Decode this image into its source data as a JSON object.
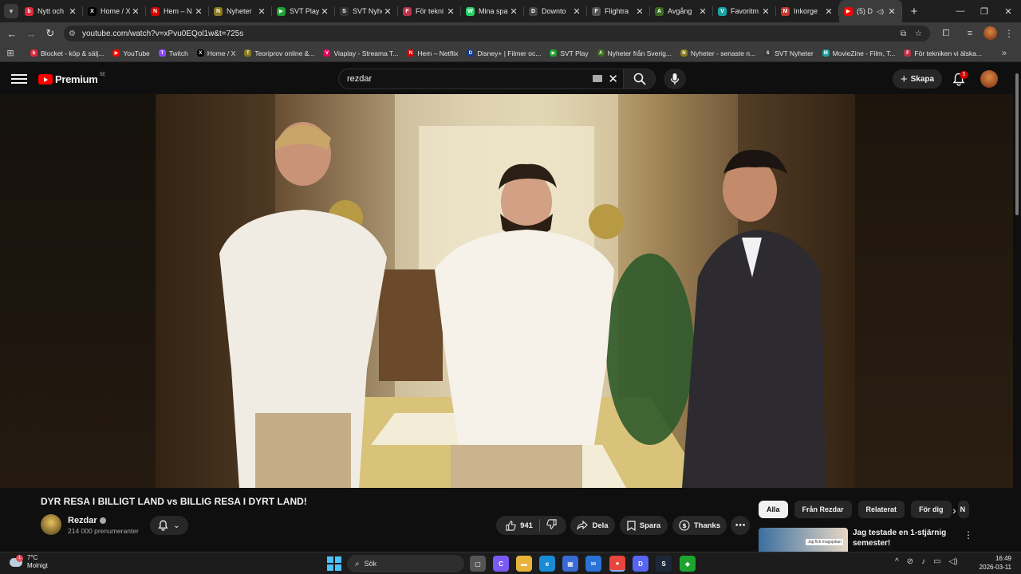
{
  "browser": {
    "tabs": [
      {
        "title": "Nytt och",
        "favicon": "red-circle-icon",
        "color": "#e0283a",
        "glyph": "b"
      },
      {
        "title": "Home / X",
        "favicon": "x-logo-icon",
        "color": "#000000",
        "glyph": "X"
      },
      {
        "title": "Hem – N",
        "favicon": "netflix-icon",
        "color": "#d80000",
        "glyph": "N"
      },
      {
        "title": "Nyheter",
        "favicon": "nyheter-icon",
        "color": "#8a7a20",
        "glyph": "N"
      },
      {
        "title": "SVT Play",
        "favicon": "play-green-icon",
        "color": "#1fa330",
        "glyph": "▶"
      },
      {
        "title": "SVT Nyhe",
        "favicon": "svt-icon",
        "color": "#333333",
        "glyph": "S"
      },
      {
        "title": "För tekni",
        "favicon": "tech-icon",
        "color": "#c03048",
        "glyph": "F"
      },
      {
        "title": "Mina spa",
        "favicon": "whatsapp-icon",
        "color": "#25d366",
        "glyph": "W"
      },
      {
        "title": "Downto",
        "favicon": "download-icon",
        "color": "#444444",
        "glyph": "D"
      },
      {
        "title": "Flightra",
        "favicon": "flight-icon",
        "color": "#555555",
        "glyph": "F"
      },
      {
        "title": "Avgång",
        "favicon": "departure-icon",
        "color": "#3a6a20",
        "glyph": "A"
      },
      {
        "title": "Favoritm",
        "favicon": "v-icon",
        "color": "#1aa3a3",
        "glyph": "V"
      },
      {
        "title": "Inkorge",
        "favicon": "gmail-icon",
        "color": "#c33a2e",
        "glyph": "M"
      },
      {
        "title": "(5) D",
        "favicon": "youtube-icon",
        "color": "#ff0000",
        "glyph": "▶"
      }
    ],
    "new_tab": "+",
    "url": "youtube.com/watch?v=xPvu0EQol1w&t=725s",
    "bookmarks": [
      {
        "label": "Blocket - köp & sälj...",
        "favicon": "blocket-icon",
        "color": "#e0283a",
        "glyph": "b"
      },
      {
        "label": "YouTube",
        "favicon": "youtube-icon",
        "color": "#ff0000",
        "glyph": "▶"
      },
      {
        "label": "Twitch",
        "favicon": "twitch-icon",
        "color": "#9146ff",
        "glyph": "T"
      },
      {
        "label": "Home / X",
        "favicon": "x-logo-icon",
        "color": "#000000",
        "glyph": "X"
      },
      {
        "label": "Teoriprov online &...",
        "favicon": "teoriprov-icon",
        "color": "#8a7a20",
        "glyph": "T"
      },
      {
        "label": "Viaplay - Streama T...",
        "favicon": "viaplay-icon",
        "color": "#e5005b",
        "glyph": "V"
      },
      {
        "label": "Hem – Netflix",
        "favicon": "netflix-icon",
        "color": "#d80000",
        "glyph": "N"
      },
      {
        "label": "Disney+ | Filmer oc...",
        "favicon": "disney-icon",
        "color": "#123a8a",
        "glyph": "D"
      },
      {
        "label": "SVT Play",
        "favicon": "play-green-icon",
        "color": "#1fa330",
        "glyph": "▶"
      },
      {
        "label": "Nyheter från Sverig...",
        "favicon": "news-icon",
        "color": "#3a6a20",
        "glyph": "A"
      },
      {
        "label": "Nyheter - senaste n...",
        "favicon": "nyheter-icon",
        "color": "#8a7a20",
        "glyph": "N"
      },
      {
        "label": "SVT Nyheter",
        "favicon": "svt-icon",
        "color": "#333333",
        "glyph": "S"
      },
      {
        "label": "MovieZine - Film, T...",
        "favicon": "moviezine-icon",
        "color": "#1aa3a3",
        "glyph": "M"
      },
      {
        "label": "För tekniken vi älska...",
        "favicon": "tech-icon",
        "color": "#c03048",
        "glyph": "F"
      }
    ]
  },
  "youtube": {
    "logo_text": "Premium",
    "logo_region": "SE",
    "search_value": "rezdar",
    "create_label": "Skapa",
    "notification_count": "5",
    "video": {
      "title": "DYR RESA I BILLIGT LAND vs BILLIG RESA I DYRT LAND!",
      "channel": "Rezdar",
      "subscribers": "214 000 prenumeranter",
      "likes": "941",
      "share_label": "Dela",
      "save_label": "Spara",
      "thanks_label": "Thanks"
    },
    "chips": [
      "Alla",
      "Från Rezdar",
      "Relaterat",
      "För dig",
      "N"
    ],
    "recommendation": {
      "title": "Jag testade en 1-stjärnig semester!",
      "thumb_text": "Jag fick magsjukan"
    }
  },
  "taskbar": {
    "weather_temp": "7°C",
    "weather_desc": "Molnigt",
    "weather_badge": "1",
    "search_label": "Sök",
    "time": "16:49",
    "date": "2026-03-11",
    "apps": [
      {
        "name": "task-view-icon",
        "color": "#555555",
        "glyph": "▢"
      },
      {
        "name": "copilot-icon",
        "color": "#7a5af5",
        "glyph": "C"
      },
      {
        "name": "file-explorer-icon",
        "color": "#e8b33a",
        "glyph": "▬"
      },
      {
        "name": "edge-icon",
        "color": "#1a8ad4",
        "glyph": "e"
      },
      {
        "name": "store-icon",
        "color": "#3a6ad4",
        "glyph": "▦"
      },
      {
        "name": "mail-icon",
        "color": "#2a72d6",
        "glyph": "✉"
      },
      {
        "name": "chrome-icon",
        "color": "#e8453c",
        "glyph": "●"
      },
      {
        "name": "discord-icon",
        "color": "#5865f2",
        "glyph": "D"
      },
      {
        "name": "steam-icon",
        "color": "#1b2838",
        "glyph": "S"
      },
      {
        "name": "app-icon",
        "color": "#1fa330",
        "glyph": "◆"
      }
    ]
  }
}
